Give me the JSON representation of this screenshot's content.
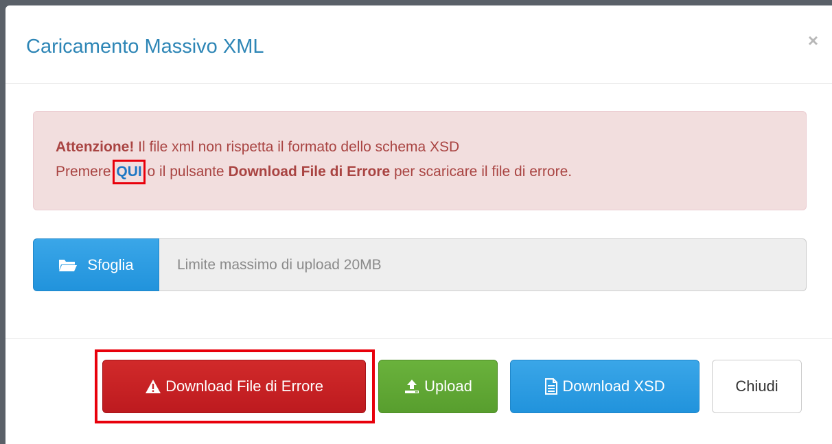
{
  "modal": {
    "title": "Caricamento Massivo XML",
    "close_symbol": "×"
  },
  "alert": {
    "strong": "Attenzione!",
    "line1_rest": " Il file xml non rispetta il formato dello schema XSD",
    "line2_prefix": "Premere ",
    "link_text": "QUI",
    "line2_middle": " o il pulsante ",
    "line2_bold": "Download File di Errore",
    "line2_suffix": " per scaricare il file di errore."
  },
  "file_input": {
    "browse_label": "Sfoglia",
    "browse_icon": "folder-open-icon",
    "placeholder": "Limite massimo di upload 20MB"
  },
  "footer": {
    "download_error_label": "Download File di Errore",
    "download_error_icon": "warning-icon",
    "upload_label": "Upload",
    "upload_icon": "upload-icon",
    "download_xsd_label": "Download XSD",
    "download_xsd_icon": "file-icon",
    "close_label": "Chiudi"
  },
  "colors": {
    "title": "#2e86b6",
    "alert_bg": "#f2dede",
    "alert_text": "#a94442",
    "danger": "#c9242a",
    "success": "#62a936",
    "info": "#2b9ce2",
    "highlight": "#e8000b"
  }
}
